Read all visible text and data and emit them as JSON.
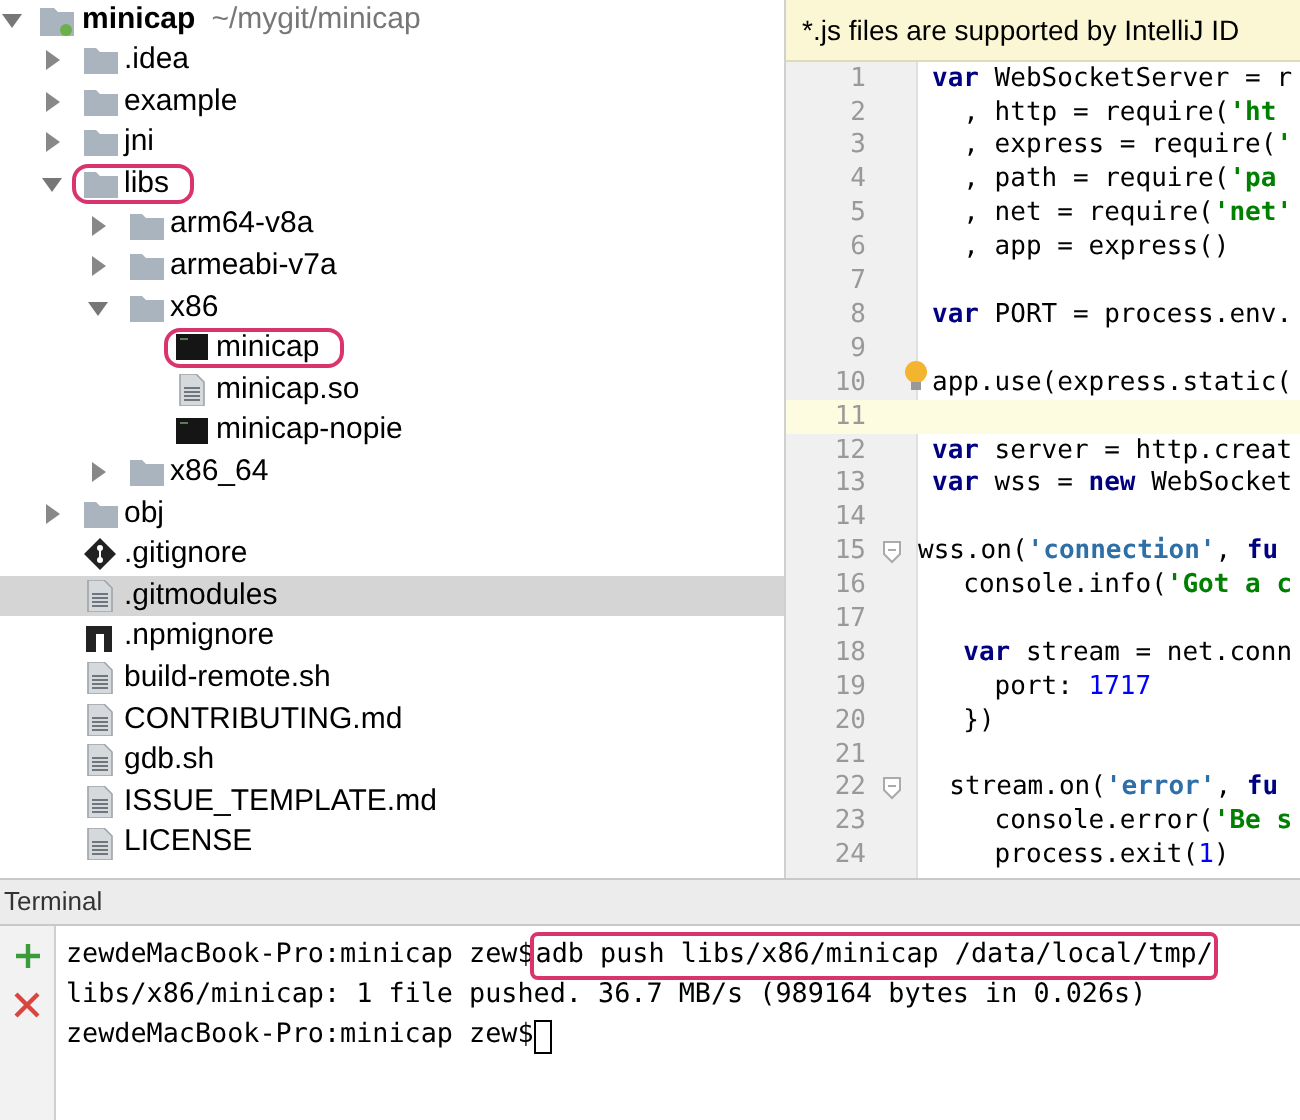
{
  "project_tree": {
    "root": {
      "name": "minicap",
      "path": "~/mygit/minicap",
      "expanded": true
    },
    "items": [
      {
        "name": ".idea",
        "kind": "folder",
        "expanded": false,
        "selected": false,
        "highlighted": false
      },
      {
        "name": "example",
        "kind": "folder",
        "expanded": false,
        "selected": false,
        "highlighted": false
      },
      {
        "name": "jni",
        "kind": "folder",
        "expanded": false,
        "selected": false,
        "highlighted": false
      },
      {
        "name": "libs",
        "kind": "folder",
        "expanded": true,
        "selected": false,
        "highlighted": true,
        "children": [
          {
            "name": "arm64-v8a",
            "kind": "folder",
            "expanded": false,
            "selected": false,
            "highlighted": false
          },
          {
            "name": "armeabi-v7a",
            "kind": "folder",
            "expanded": false,
            "selected": false,
            "highlighted": false
          },
          {
            "name": "x86",
            "kind": "folder",
            "expanded": true,
            "selected": false,
            "highlighted": false,
            "children": [
              {
                "name": "minicap",
                "kind": "binary",
                "selected": false,
                "highlighted": true
              },
              {
                "name": "minicap.so",
                "kind": "text",
                "selected": false,
                "highlighted": false
              },
              {
                "name": "minicap-nopie",
                "kind": "binary",
                "selected": false,
                "highlighted": false
              }
            ]
          },
          {
            "name": "x86_64",
            "kind": "folder",
            "expanded": false,
            "selected": false,
            "highlighted": false
          }
        ]
      },
      {
        "name": "obj",
        "kind": "folder",
        "expanded": false,
        "selected": false,
        "highlighted": false
      },
      {
        "name": ".gitignore",
        "kind": "git",
        "selected": false,
        "highlighted": false
      },
      {
        "name": ".gitmodules",
        "kind": "text",
        "selected": true,
        "highlighted": false
      },
      {
        "name": ".npmignore",
        "kind": "npm",
        "selected": false,
        "highlighted": false
      },
      {
        "name": "build-remote.sh",
        "kind": "text",
        "selected": false,
        "highlighted": false
      },
      {
        "name": "CONTRIBUTING.md",
        "kind": "text",
        "selected": false,
        "highlighted": false
      },
      {
        "name": "gdb.sh",
        "kind": "text",
        "selected": false,
        "highlighted": false
      },
      {
        "name": "ISSUE_TEMPLATE.md",
        "kind": "text",
        "selected": false,
        "highlighted": false
      },
      {
        "name": "LICENSE",
        "kind": "text",
        "selected": false,
        "highlighted": false
      }
    ]
  },
  "editor": {
    "banner": "*.js files are supported by IntelliJ ID",
    "lines": [
      {
        "number": "1",
        "tokens": [
          {
            "text": "var",
            "kind": "keyword"
          },
          {
            "text": " WebSocketServer = r",
            "kind": "plain"
          }
        ]
      },
      {
        "number": "2",
        "tokens": [
          {
            "text": "  , http = require(",
            "kind": "plain"
          },
          {
            "text": "'ht",
            "kind": "string"
          }
        ]
      },
      {
        "number": "3",
        "tokens": [
          {
            "text": "  , express = require(",
            "kind": "plain"
          },
          {
            "text": "'",
            "kind": "string"
          }
        ]
      },
      {
        "number": "4",
        "tokens": [
          {
            "text": "  , path = require(",
            "kind": "plain"
          },
          {
            "text": "'pa",
            "kind": "string"
          }
        ]
      },
      {
        "number": "5",
        "tokens": [
          {
            "text": "  , net = require(",
            "kind": "plain"
          },
          {
            "text": "'net'",
            "kind": "string"
          }
        ]
      },
      {
        "number": "6",
        "tokens": [
          {
            "text": "  , app = express()",
            "kind": "plain"
          }
        ]
      },
      {
        "number": "7"
      },
      {
        "number": "8",
        "tokens": [
          {
            "text": "var",
            "kind": "keyword"
          },
          {
            "text": " PORT = process.env.",
            "kind": "plain"
          }
        ]
      },
      {
        "number": "9"
      },
      {
        "number": "10",
        "tokens": [
          {
            "text": "app.use(express.static(",
            "kind": "plain"
          }
        ],
        "intention_bulb": true
      },
      {
        "number": "11",
        "current": true
      },
      {
        "number": "12",
        "tokens": [
          {
            "text": "var",
            "kind": "keyword"
          },
          {
            "text": " server = http.creat",
            "kind": "plain"
          }
        ]
      },
      {
        "number": "13",
        "tokens": [
          {
            "text": "var",
            "kind": "keyword"
          },
          {
            "text": " wss = ",
            "kind": "plain"
          },
          {
            "text": "new",
            "kind": "keyword"
          },
          {
            "text": " WebSocket",
            "kind": "plain"
          }
        ]
      },
      {
        "number": "14"
      },
      {
        "number": "15",
        "tokens": [
          {
            "text": "wss.on(",
            "kind": "plain"
          },
          {
            "text": "'connection'",
            "kind": "string_blue"
          },
          {
            "text": ", ",
            "kind": "plain"
          },
          {
            "text": "fu",
            "kind": "keyword"
          }
        ],
        "fold": true
      },
      {
        "number": "16",
        "tokens": [
          {
            "text": "  console.info(",
            "kind": "plain"
          },
          {
            "text": "'Got a c",
            "kind": "string"
          }
        ]
      },
      {
        "number": "17"
      },
      {
        "number": "18",
        "tokens": [
          {
            "text": "  var",
            "kind": "keyword"
          },
          {
            "text": " stream = net.conn",
            "kind": "plain"
          }
        ]
      },
      {
        "number": "19",
        "tokens": [
          {
            "text": "    port: ",
            "kind": "plain"
          },
          {
            "text": "1717",
            "kind": "number"
          }
        ]
      },
      {
        "number": "20",
        "tokens": [
          {
            "text": "  })",
            "kind": "plain"
          }
        ]
      },
      {
        "number": "21"
      },
      {
        "number": "22",
        "tokens": [
          {
            "text": "  stream.on(",
            "kind": "plain"
          },
          {
            "text": "'error'",
            "kind": "string_blue"
          },
          {
            "text": ", ",
            "kind": "plain"
          },
          {
            "text": "fu",
            "kind": "keyword"
          }
        ],
        "fold": true
      },
      {
        "number": "23",
        "tokens": [
          {
            "text": "    console.error(",
            "kind": "plain"
          },
          {
            "text": "'Be s",
            "kind": "string"
          }
        ]
      },
      {
        "number": "24",
        "tokens": [
          {
            "text": "    process.exit(",
            "kind": "plain"
          },
          {
            "text": "1",
            "kind": "number"
          },
          {
            "text": ")",
            "kind": "plain"
          }
        ]
      }
    ]
  },
  "terminal": {
    "title": "Terminal",
    "lines": [
      {
        "prompt": "zewdeMacBook-Pro:minicap zew$ ",
        "command": "adb push libs/x86/minicap /data/local/tmp/",
        "highlighted": true
      },
      {
        "output": "libs/x86/minicap: 1 file pushed. 36.7 MB/s (989164 bytes in 0.026s)"
      },
      {
        "prompt": "zewdeMacBook-Pro:minicap zew$",
        "cursor": true
      }
    ]
  }
}
